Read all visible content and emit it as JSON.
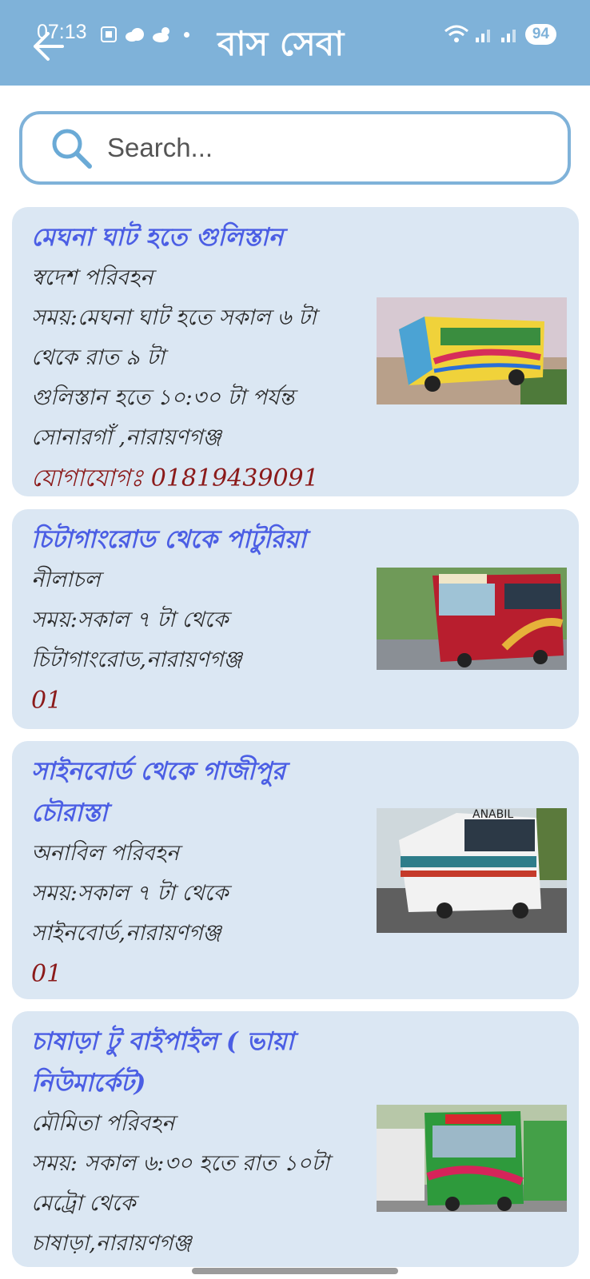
{
  "status": {
    "time": "07:13",
    "battery": "94"
  },
  "header": {
    "title": "বাস সেবা"
  },
  "search": {
    "placeholder": "Search..."
  },
  "cards": [
    {
      "route": "মেঘনা ঘাট হতে গুলিস্তান",
      "company": "স্বদেশ পরিবহন",
      "time_line1": "সময়:মেঘনা ঘাট হতে সকাল ৬ টা",
      "time_line2": "থেকে রাত ৯ টা",
      "time_line3": "গুলিস্তান হতে  ১০:৩০ টা পর্যন্ত",
      "location": "সোনারগাঁ ,নারায়ণগঞ্জ",
      "contact": "যোগাযোগঃ 01819439091"
    },
    {
      "route": "চিটাগাংরোড থেকে পাটুরিয়া",
      "company": "নীলাচল",
      "time_line1": "সময়:সকাল ৭ টা থেকে",
      "location": "চিটাগাংরোড,নারায়ণগঞ্জ",
      "contact": "01"
    },
    {
      "route_line1": "সাইনবোর্ড থেকে গাজীপুর",
      "route_line2": "চৌরাস্তা",
      "company": "অনাবিল পরিবহন",
      "time_line1": "সময়:সকাল ৭ টা থেকে",
      "location": "সাইনবোর্ড,নারায়ণগঞ্জ",
      "contact": "01"
    },
    {
      "route_line1": "চাষাড়া টু বাইপাইল ( ভায়া",
      "route_line2": "নিউমার্কেট)",
      "company": "মৌমিতা পরিবহন",
      "time_line1": "সময়: সকাল ৬:৩০ হতে রাত ১০টা",
      "time_line2": "মেট্রো থেকে",
      "location": "চাষাড়া,নারায়ণগঞ্জ"
    }
  ],
  "bus_labels": [
    "ANABIL"
  ],
  "colors": {
    "appbar": "#7fb2d9",
    "card_bg": "#dbe7f3",
    "route": "#4b5ee4",
    "contact": "#8b1a1a"
  },
  "icons": [
    "back-arrow-icon",
    "search-icon",
    "wifi-icon",
    "signal-icon",
    "cloud-icon"
  ]
}
